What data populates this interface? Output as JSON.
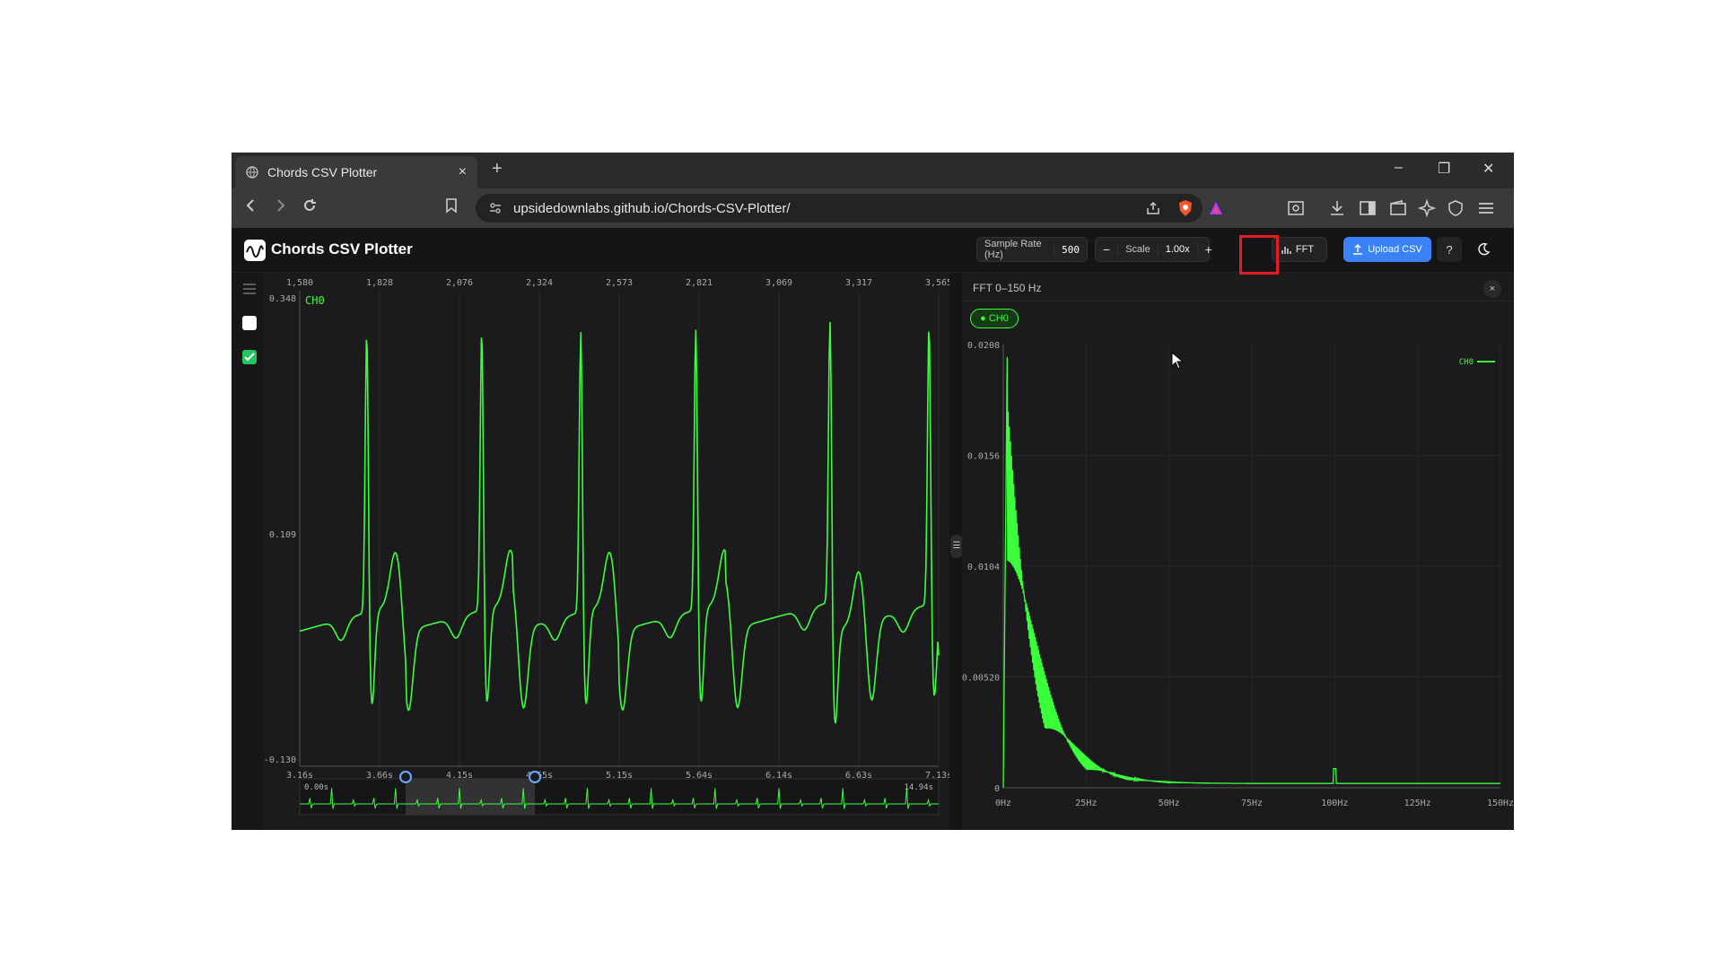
{
  "browser": {
    "tab_title": "Chords CSV Plotter",
    "tab_close": "×",
    "new_tab": "+",
    "url": "upsidedownlabs.github.io/Chords-CSV-Plotter/",
    "win_min": "–",
    "win_restore": "❐",
    "win_close": "✕"
  },
  "app": {
    "title": "Chords CSV Plotter",
    "sample_rate_label": "Sample Rate (Hz)",
    "sample_rate_value": "500",
    "scale_minus": "−",
    "scale_label": "Scale",
    "scale_value": "1.00x",
    "scale_plus": "+",
    "fft_button": "FFT",
    "upload_button": "Upload CSV",
    "help_button": "?",
    "theme_button": "◐"
  },
  "sidebar": {
    "checkbox1_checked": false,
    "checkbox2_checked": true
  },
  "time_plot": {
    "sample_ticks": [
      "1,580",
      "1,828",
      "2,076",
      "2,324",
      "2,573",
      "2,821",
      "3,069",
      "3,317",
      "3,565"
    ],
    "y_ticks": [
      "0.348",
      "0.109",
      "-0.130"
    ],
    "x_time_ticks": [
      "3.16s",
      "3.66s",
      "4.15s",
      "4.65s",
      "5.15s",
      "5.64s",
      "6.14s",
      "6.63s",
      "7.13s"
    ],
    "channel_label": "CH0",
    "overview_start": "0.00s",
    "overview_end": "14.94s",
    "line_color": "#3cff3c"
  },
  "fft_plot": {
    "title": "FFT 0–150 Hz",
    "close": "×",
    "channel_pill": "● CH0",
    "legend": "CH0",
    "y_ticks": [
      "0.0208",
      "0.0156",
      "0.0104",
      "0.00520",
      "0"
    ],
    "x_ticks": [
      "0Hz",
      "25Hz",
      "50Hz",
      "75Hz",
      "100Hz",
      "125Hz",
      "150Hz"
    ],
    "line_color": "#3cff3c"
  }
}
